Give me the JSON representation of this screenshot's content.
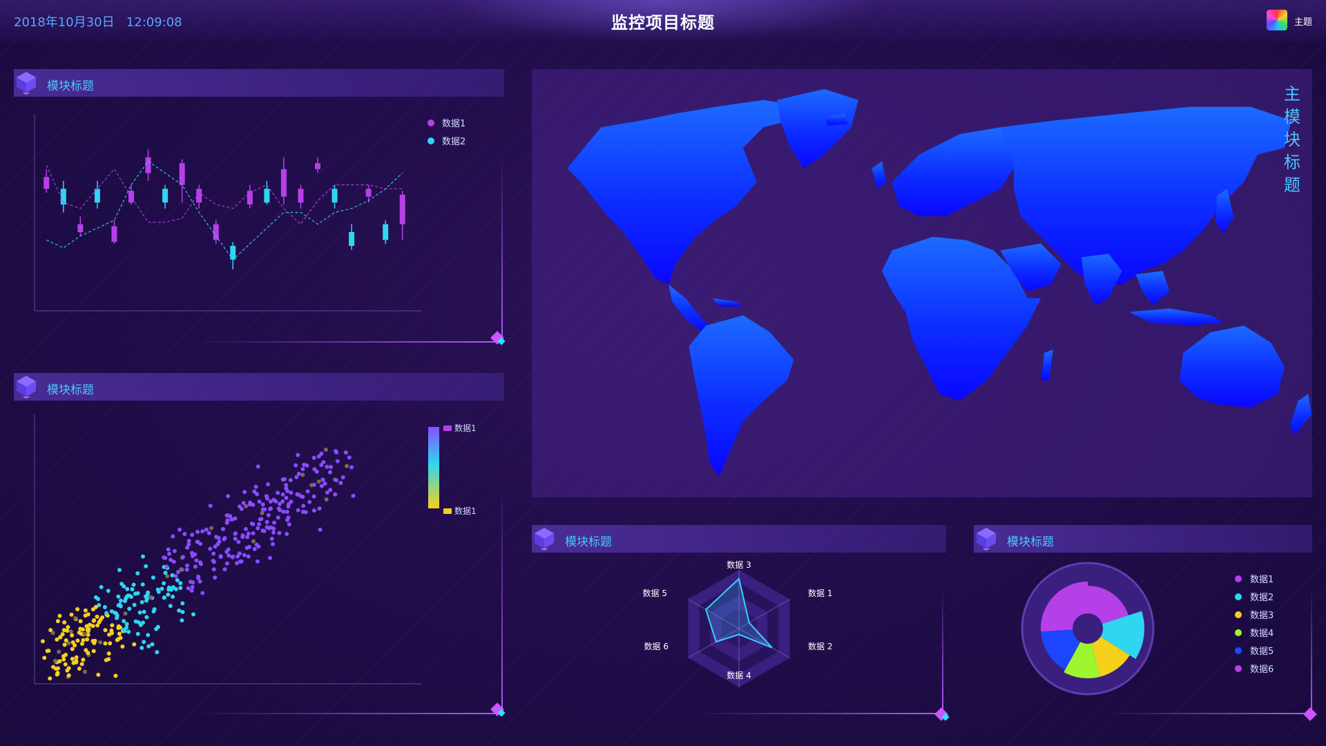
{
  "header": {
    "date": "2018年10月30日",
    "time": "12:09:08",
    "title": "监控项目标题",
    "theme_label": "主题"
  },
  "colors": {
    "background": "#1f0c48",
    "accent_purple": "#b640e8",
    "accent_cyan": "#2fd6f0",
    "accent_yellow": "#f5d11b",
    "map_blue": "#0b2bff",
    "title_cyan": "#48c8ff"
  },
  "panels": {
    "candlestick": {
      "title": "模块标题",
      "icon": "cube-icon",
      "chart_data": {
        "type": "candlestick",
        "series": [
          {
            "name": "数据1",
            "color": "#b640e8"
          },
          {
            "name": "数据2",
            "color": "#2fd6f0"
          }
        ],
        "candles": [
          {
            "open": 0.62,
            "close": 0.68,
            "high": 0.72,
            "low": 0.6,
            "series": 0
          },
          {
            "open": 0.54,
            "close": 0.62,
            "high": 0.66,
            "low": 0.5,
            "series": 1
          },
          {
            "open": 0.4,
            "close": 0.44,
            "high": 0.48,
            "low": 0.38,
            "series": 0
          },
          {
            "open": 0.55,
            "close": 0.62,
            "high": 0.66,
            "low": 0.52,
            "series": 1
          },
          {
            "open": 0.35,
            "close": 0.43,
            "high": 0.46,
            "low": 0.34,
            "series": 0
          },
          {
            "open": 0.55,
            "close": 0.61,
            "high": 0.64,
            "low": 0.54,
            "series": 0
          },
          {
            "open": 0.7,
            "close": 0.78,
            "high": 0.82,
            "low": 0.66,
            "series": 0
          },
          {
            "open": 0.55,
            "close": 0.62,
            "high": 0.64,
            "low": 0.52,
            "series": 1
          },
          {
            "open": 0.64,
            "close": 0.75,
            "high": 0.77,
            "low": 0.55,
            "series": 0
          },
          {
            "open": 0.55,
            "close": 0.62,
            "high": 0.64,
            "low": 0.52,
            "series": 0
          },
          {
            "open": 0.36,
            "close": 0.44,
            "high": 0.46,
            "low": 0.34,
            "series": 0
          },
          {
            "open": 0.26,
            "close": 0.33,
            "high": 0.35,
            "low": 0.21,
            "series": 1
          },
          {
            "open": 0.54,
            "close": 0.61,
            "high": 0.64,
            "low": 0.52,
            "series": 0
          },
          {
            "open": 0.55,
            "close": 0.62,
            "high": 0.66,
            "low": 0.54,
            "series": 1
          },
          {
            "open": 0.58,
            "close": 0.72,
            "high": 0.78,
            "low": 0.54,
            "series": 0
          },
          {
            "open": 0.55,
            "close": 0.62,
            "high": 0.64,
            "low": 0.52,
            "series": 0
          },
          {
            "open": 0.72,
            "close": 0.75,
            "high": 0.78,
            "low": 0.7,
            "series": 0
          },
          {
            "open": 0.55,
            "close": 0.62,
            "high": 0.64,
            "low": 0.52,
            "series": 1
          },
          {
            "open": 0.33,
            "close": 0.4,
            "high": 0.44,
            "low": 0.31,
            "series": 1
          },
          {
            "open": 0.58,
            "close": 0.62,
            "high": 0.64,
            "low": 0.55,
            "series": 0
          },
          {
            "open": 0.36,
            "close": 0.44,
            "high": 0.46,
            "low": 0.34,
            "series": 1
          },
          {
            "open": 0.44,
            "close": 0.59,
            "high": 0.61,
            "low": 0.36,
            "series": 0
          }
        ],
        "line1": [
          0.74,
          0.55,
          0.52,
          0.62,
          0.72,
          0.58,
          0.45,
          0.45,
          0.47,
          0.6,
          0.54,
          0.52,
          0.6,
          0.64,
          0.52,
          0.44,
          0.56,
          0.64,
          0.64,
          0.64,
          0.62,
          0.62
        ],
        "line2": [
          0.36,
          0.32,
          0.38,
          0.42,
          0.46,
          0.64,
          0.76,
          0.7,
          0.64,
          0.5,
          0.38,
          0.26,
          0.34,
          0.42,
          0.5,
          0.5,
          0.44,
          0.5,
          0.52,
          0.56,
          0.62,
          0.7
        ]
      }
    },
    "scatter": {
      "title": "模块标题",
      "icon": "cube-icon",
      "visual_map": {
        "top_label": "数据1",
        "bottom_label": "数据1"
      },
      "chart_data": {
        "type": "scatter",
        "note_colors": [
          "#8a4cff",
          "#2fd6f0",
          "#f5d11b"
        ]
      }
    },
    "map": {
      "title_vertical": "主模块标题",
      "fill_top": "#1c6bff",
      "fill_bottom": "#0a06ff"
    },
    "radar": {
      "title": "模块标题",
      "icon": "cube-icon",
      "chart_data": {
        "type": "radar",
        "indicators": [
          "数据 3",
          "数据 1",
          "数据 2",
          "数据 4",
          "数据 6",
          "数据 5"
        ],
        "values": [
          0.85,
          0.2,
          0.65,
          0.1,
          0.45,
          0.65
        ]
      }
    },
    "pie": {
      "title": "模块标题",
      "icon": "cube-icon",
      "chart_data": {
        "type": "pie",
        "series": [
          {
            "name": "数据1",
            "value": 20,
            "color": "#b640e8"
          },
          {
            "name": "数据2",
            "value": 14,
            "color": "#2fd6f0"
          },
          {
            "name": "数据3",
            "value": 12,
            "color": "#f5d11b"
          },
          {
            "name": "数据4",
            "value": 12,
            "color": "#9ef530"
          },
          {
            "name": "数据5",
            "value": 16,
            "color": "#1d46ff"
          },
          {
            "name": "数据6",
            "value": 26,
            "color": "#b640e8"
          }
        ]
      }
    }
  }
}
